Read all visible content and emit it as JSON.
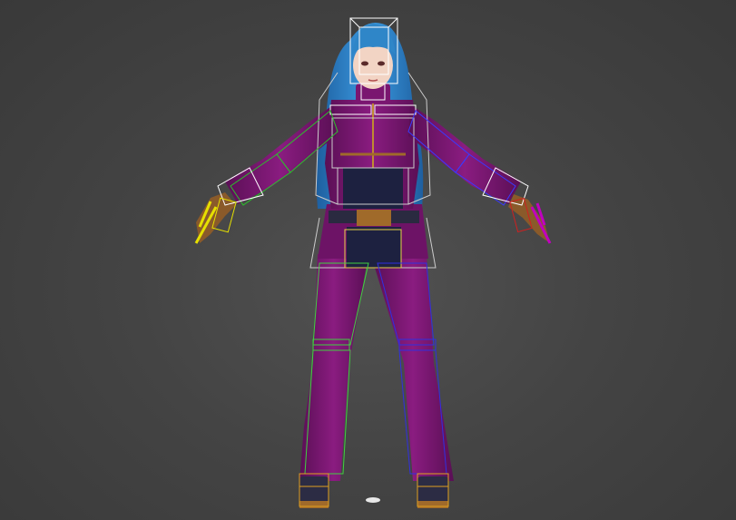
{
  "viewport": {
    "background": "#464646",
    "content": "rigged-character-tpose"
  },
  "character": {
    "hair_color": "#2f86c8",
    "suit_color": "#7a1670",
    "suit_dark": "#4a0c45",
    "undershirt_color": "#1d2140",
    "skin_color": "#f2d4c4",
    "belt_color": "#a06a2a",
    "boot_color": "#2c2c44",
    "glove_color": "#8a5a2a"
  },
  "rig": {
    "spine_bone_color": "#ffffff",
    "left_arm_bone_color": "#2cc02c",
    "right_arm_bone_color": "#3a3aff",
    "left_hand_bone_color": "#e6e000",
    "right_hand_bone_color": "#d02020",
    "right_finger_bone_color": "#c000c0",
    "pelvis_bone_color": "#e6d24a",
    "foot_bone_color": "#e0a020",
    "leg_left_bone_color": "#40d040",
    "leg_right_bone_color": "#3030e0"
  }
}
